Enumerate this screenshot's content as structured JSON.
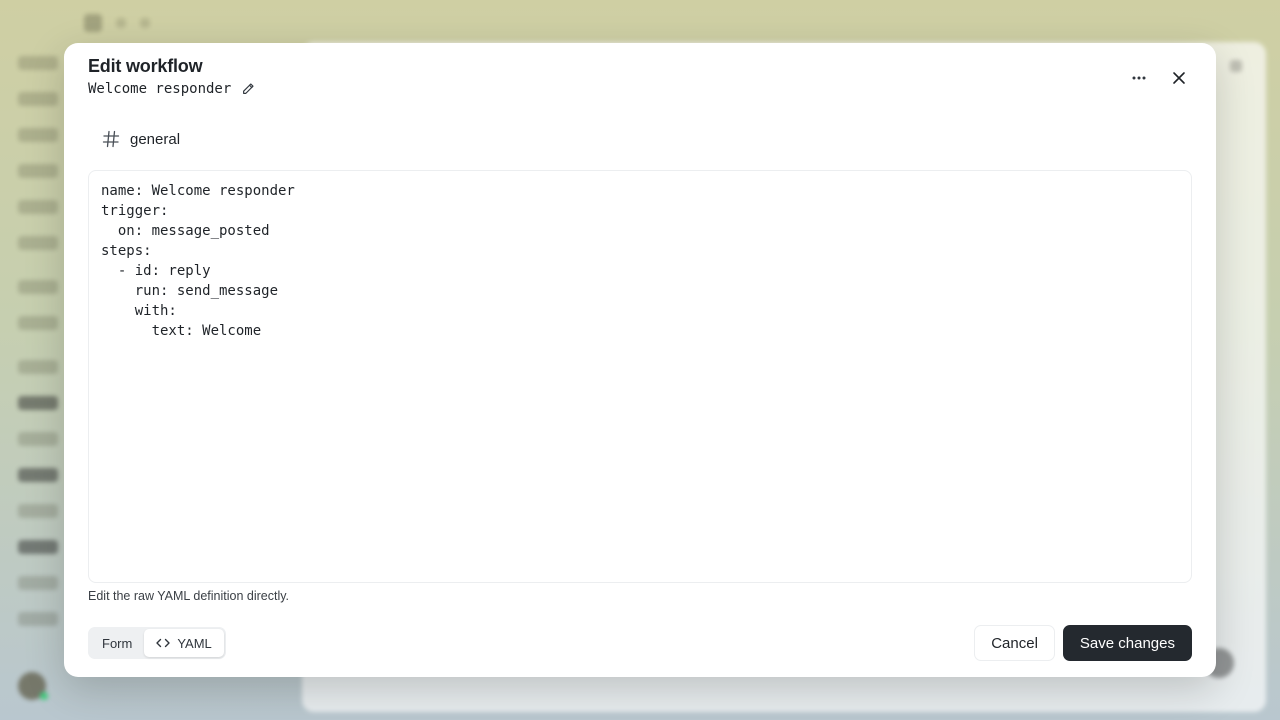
{
  "modal": {
    "title": "Edit workflow",
    "workflow_name": "Welcome responder",
    "icons": {
      "edit_name": "pencil-icon",
      "more": "more-horizontal-icon",
      "close": "close-icon",
      "channel": "hash-icon",
      "yaml_mode": "code-icon"
    },
    "channel": "general",
    "yaml": "name: Welcome responder\ntrigger:\n  on: message_posted\nsteps:\n  - id: reply\n    run: send_message\n    with:\n      text: Welcome",
    "hint": "Edit the raw YAML definition directly.",
    "mode_toggle": {
      "form_label": "Form",
      "yaml_label": "YAML",
      "active": "YAML"
    },
    "cancel_label": "Cancel",
    "save_label": "Save changes"
  },
  "colors": {
    "primary_button": "#24292f",
    "backdrop_top": "#cfcfa3",
    "backdrop_bottom": "#b9c7cf"
  }
}
